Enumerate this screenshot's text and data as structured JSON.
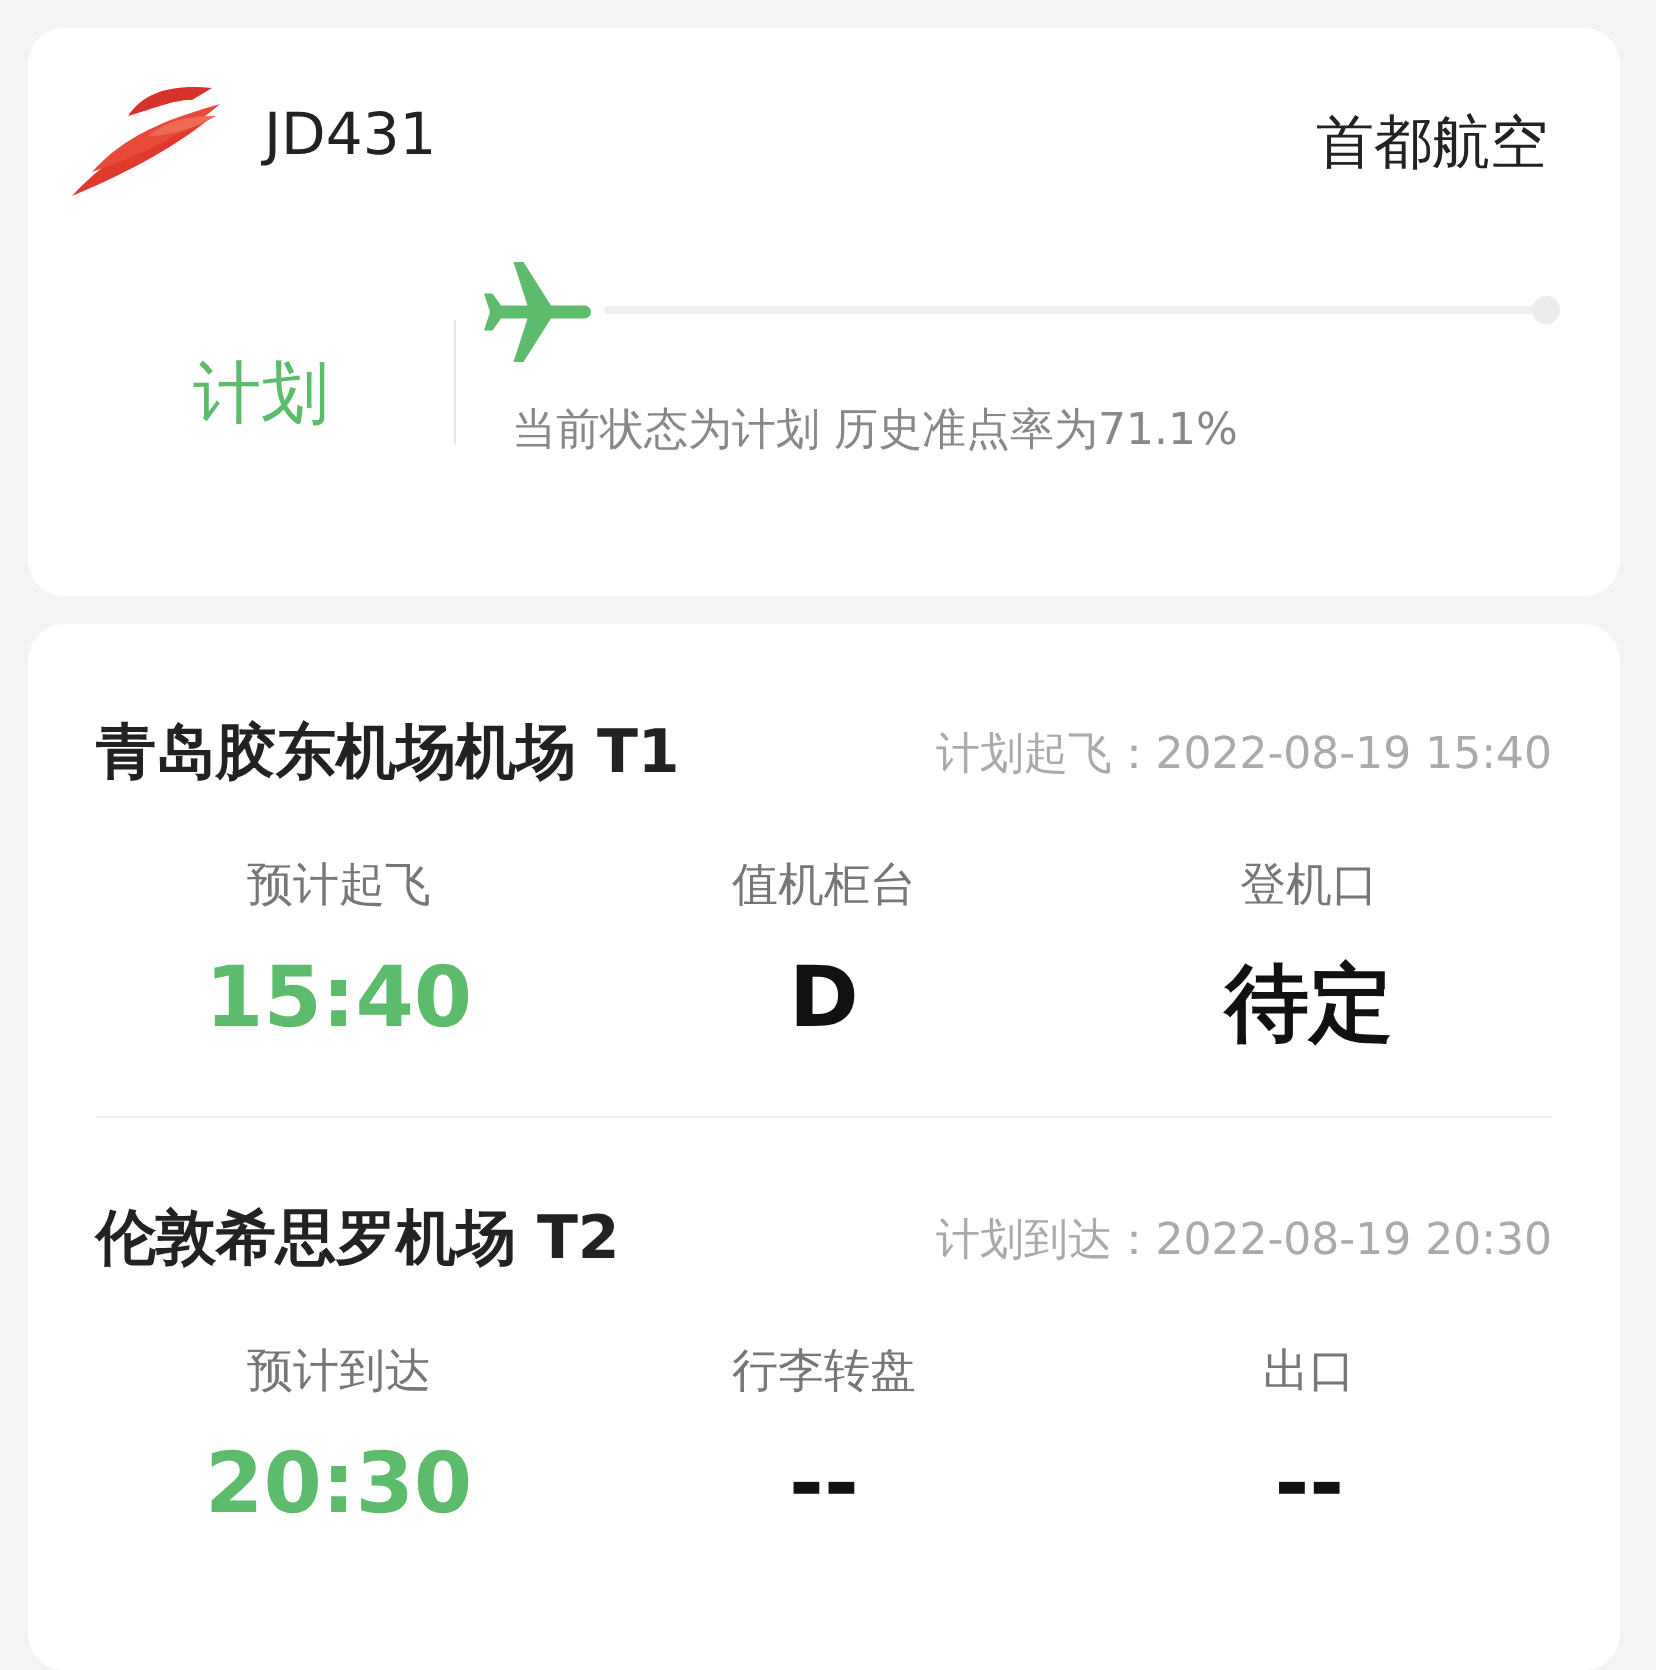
{
  "flight": {
    "number": "JD431",
    "airline": "首都航空"
  },
  "status": {
    "label": "计划",
    "caption": "当前状态为计划 历史准点率为71.1%"
  },
  "legs": [
    {
      "airport": "青岛胶东机场机场 T1",
      "scheduled": "计划起飞：2022-08-19 15:40",
      "fields": [
        {
          "label": "预计起飞",
          "value": "15:40",
          "kind": "time"
        },
        {
          "label": "值机柜台",
          "value": "D",
          "kind": "plain"
        },
        {
          "label": "登机口",
          "value": "待定",
          "kind": "plain"
        }
      ]
    },
    {
      "airport": "伦敦希思罗机场 T2",
      "scheduled": "计划到达：2022-08-19 20:30",
      "fields": [
        {
          "label": "预计到达",
          "value": "20:30",
          "kind": "time"
        },
        {
          "label": "行李转盘",
          "value": "--",
          "kind": "plain"
        },
        {
          "label": "出口",
          "value": "--",
          "kind": "plain"
        }
      ]
    }
  ]
}
